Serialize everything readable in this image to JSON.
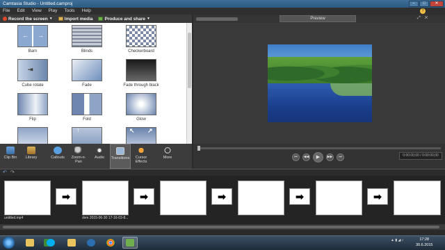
{
  "window": {
    "title": "Camtasia Studio - Untitled.camproj",
    "controls": [
      "–",
      "□",
      "✕"
    ]
  },
  "menu": [
    "File",
    "Edit",
    "View",
    "Play",
    "Tools",
    "Help"
  ],
  "toolbar": {
    "record": "Record the screen",
    "import": "Import media",
    "produce": "Produce and share"
  },
  "preview": {
    "label": "Preview",
    "timecode": "0:00:00;00 / 0:00:00;00"
  },
  "transitions": [
    {
      "label": "Barn",
      "icon": "barn-transition-icon"
    },
    {
      "label": "Blinds",
      "icon": "blinds-transition-icon"
    },
    {
      "label": "Checkerboard",
      "icon": "checkerboard-transition-icon"
    },
    {
      "label": "Cube rotate",
      "icon": "cube-rotate-transition-icon"
    },
    {
      "label": "Fade",
      "icon": "fade-transition-icon"
    },
    {
      "label": "Fade through black",
      "icon": "fade-black-transition-icon"
    },
    {
      "label": "Flip",
      "icon": "flip-transition-icon"
    },
    {
      "label": "Fold",
      "icon": "fold-transition-icon"
    },
    {
      "label": "Glow",
      "icon": "glow-transition-icon"
    },
    {
      "label": "",
      "icon": "transition-icon"
    },
    {
      "label": "",
      "icon": "transition-icon"
    },
    {
      "label": "",
      "icon": "transition-icon"
    }
  ],
  "tool_tabs": [
    {
      "label": "Clip Bin",
      "icon": "clip-bin-icon"
    },
    {
      "label": "Library",
      "icon": "library-icon"
    },
    {
      "label": "Callouts",
      "icon": "callouts-icon"
    },
    {
      "label": "Zoom-n-Pan",
      "icon": "zoom-icon"
    },
    {
      "label": "Audio",
      "icon": "audio-icon"
    },
    {
      "label": "Transitions",
      "icon": "transitions-icon"
    },
    {
      "label": "Cursor Effects",
      "icon": "cursor-effects-icon"
    },
    {
      "label": "More",
      "icon": "more-icon"
    }
  ],
  "timeline": {
    "clips": [
      "untitled.mp4",
      "dvm 2015-06-30 17-16-03-8...",
      "",
      "",
      "",
      ""
    ],
    "transition_glyph": "➡"
  },
  "taskbar": {
    "apps": [
      "explorer-icon",
      "camtasia-icon",
      "skype-icon",
      "folder-icon",
      "flash-icon",
      "chrome-icon",
      "camtasia-recorder-icon"
    ],
    "time": "17:28",
    "date": "30.6.2015",
    "colors": {
      "accent": "#3d6f98",
      "record": "#e04a2a"
    }
  }
}
